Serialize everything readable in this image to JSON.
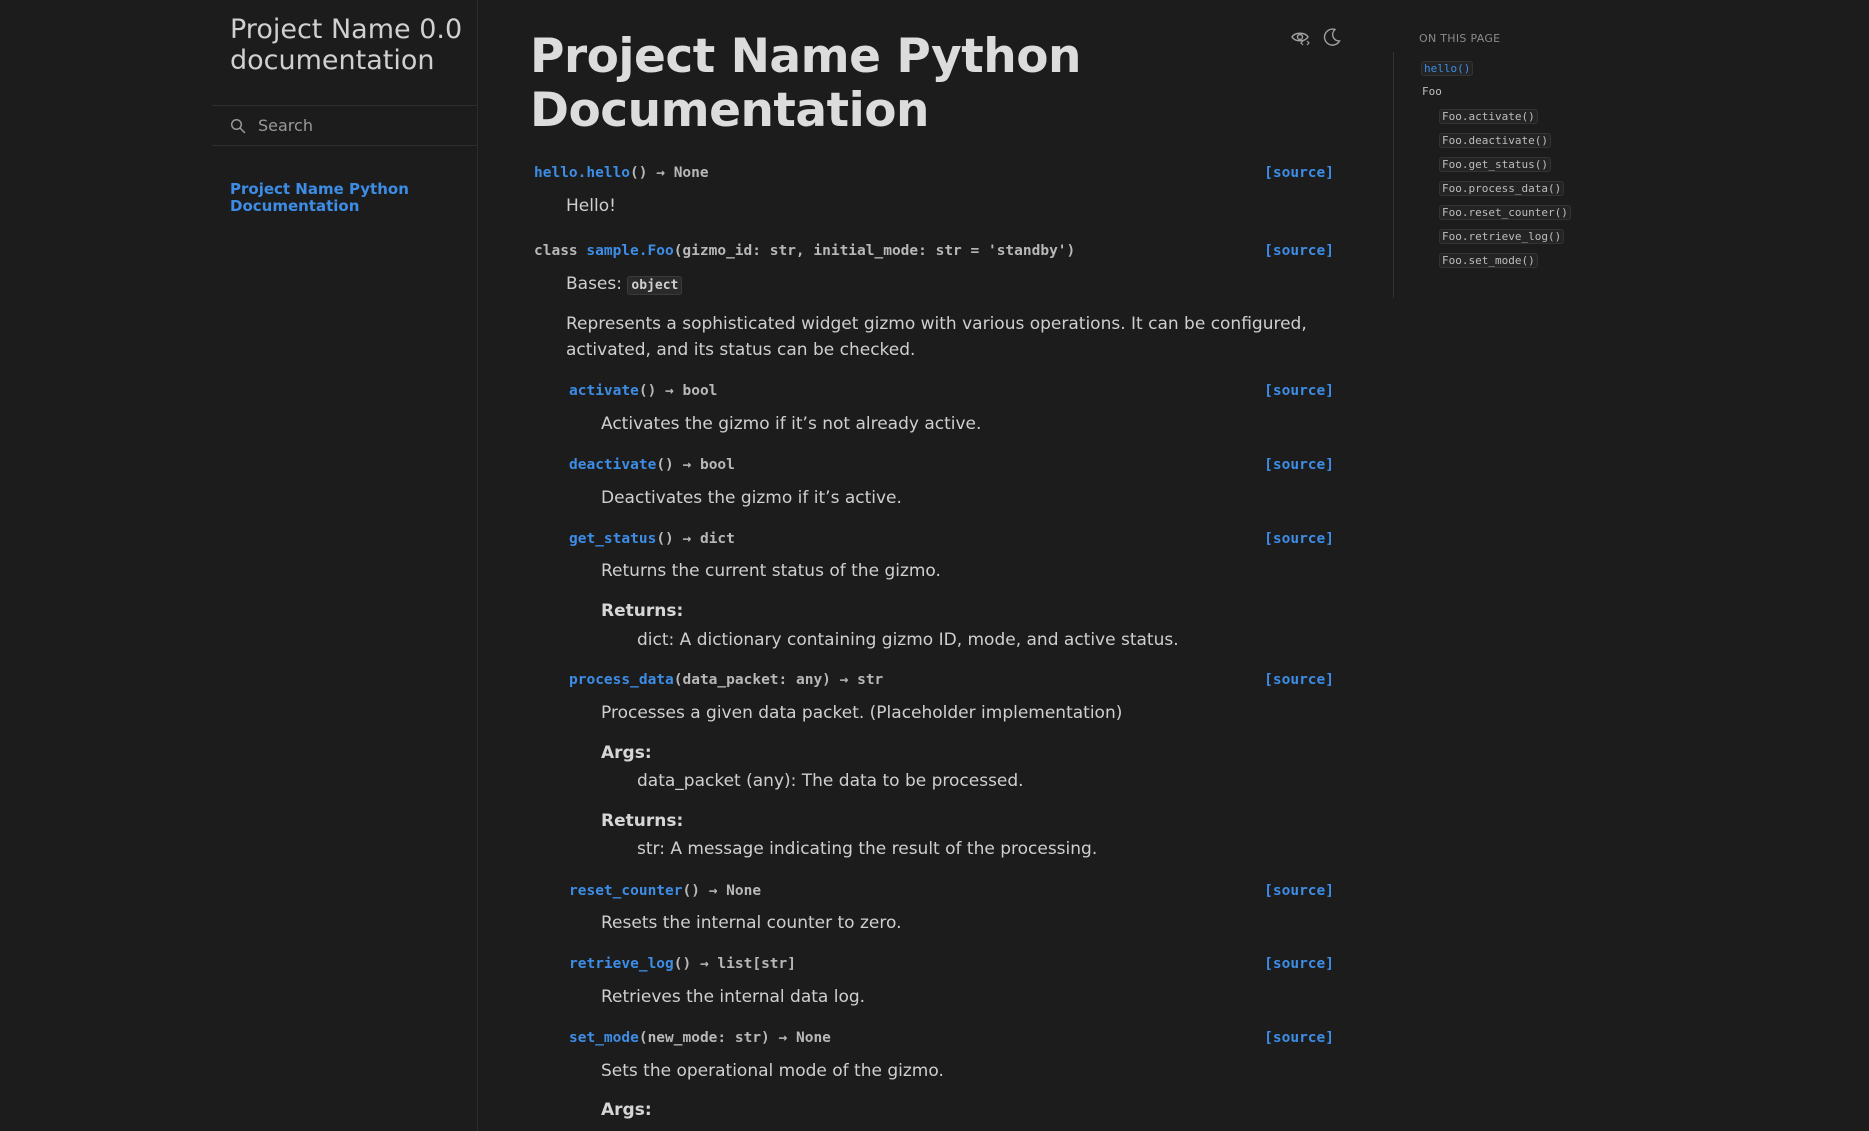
{
  "sidebar": {
    "brand": "Project Name 0.0 documentation",
    "search_placeholder": "Search",
    "nav_link": "Project Name Python Documentation"
  },
  "main": {
    "title": "Project Name Python Documentation",
    "source_label": "[source]",
    "hello": {
      "prefix": "hello.",
      "name": "hello",
      "rest": "() → None",
      "doc": "Hello!"
    },
    "foo": {
      "keyword": "class ",
      "prefix": "sample.",
      "name": "Foo",
      "params": "(gizmo_id: str, initial_mode: str = 'standby')",
      "bases_label": "Bases:",
      "bases_value": "object",
      "description": "Represents a sophisticated widget gizmo with various operations. It can be configured, activated, and its status can be checked."
    },
    "methods": [
      {
        "name": "activate",
        "rest": "() → bool",
        "doc": "Activates the gizmo if it’s not already active."
      },
      {
        "name": "deactivate",
        "rest": "() → bool",
        "doc": "Deactivates the gizmo if it’s active."
      },
      {
        "name": "get_status",
        "rest": "() → dict",
        "doc": "Returns the current status of the gizmo.",
        "returns_label": "Returns:",
        "returns": "dict: A dictionary containing gizmo ID, mode, and active status."
      },
      {
        "name": "process_data",
        "rest": "(data_packet: any) → str",
        "doc": "Processes a given data packet. (Placeholder implementation)",
        "args_label": "Args:",
        "args": "data_packet (any): The data to be processed.",
        "returns_label": "Returns:",
        "returns": "str: A message indicating the result of the processing."
      },
      {
        "name": "reset_counter",
        "rest": "() → None",
        "doc": "Resets the internal counter to zero."
      },
      {
        "name": "retrieve_log",
        "rest": "() → list[str]",
        "doc": "Retrieves the internal data log."
      },
      {
        "name": "set_mode",
        "rest": "(new_mode: str) → None",
        "doc": "Sets the operational mode of the gizmo.",
        "args_label": "Args:"
      }
    ]
  },
  "toc": {
    "heading": "ON THIS PAGE",
    "items": [
      "hello()",
      "Foo",
      "Foo.activate()",
      "Foo.deactivate()",
      "Foo.get_status()",
      "Foo.process_data()",
      "Foo.reset_counter()",
      "Foo.retrieve_log()",
      "Foo.set_mode()"
    ]
  },
  "colors": {
    "background": "#1c1c1c",
    "link": "#3d8de6",
    "text": "#cfcfcf"
  },
  "icons": [
    "search-icon",
    "view-source-icon",
    "moon-icon"
  ]
}
